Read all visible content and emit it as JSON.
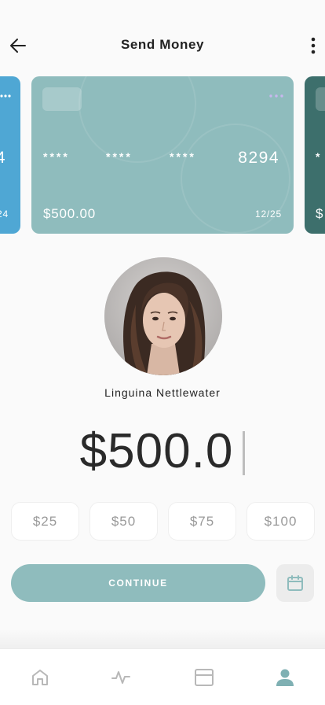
{
  "header": {
    "title": "Send Money",
    "back_icon": "arrow-left-icon",
    "menu_icon": "more-vertical-icon"
  },
  "cards": [
    {
      "partial": "left",
      "last4": "4",
      "expiry": "24",
      "color": "#4fa7d4"
    },
    {
      "partial": "none",
      "mask": [
        "****",
        "****",
        "****"
      ],
      "last4": "8294",
      "balance": "$500.00",
      "expiry": "12/25",
      "color": "#8fbcbd"
    },
    {
      "partial": "right",
      "mask_fragment": "*",
      "balance_fragment": "$",
      "color": "#3d6f6c"
    }
  ],
  "recipient": {
    "name": "Linguina Nettlewater"
  },
  "amount": {
    "value": "$500.0"
  },
  "quick_amounts": [
    "$25",
    "$50",
    "$75",
    "$100"
  ],
  "actions": {
    "continue_label": "CONTINUE",
    "schedule_icon": "calendar-icon"
  },
  "tabbar": {
    "items": [
      {
        "icon": "home-icon",
        "active": false
      },
      {
        "icon": "activity-icon",
        "active": false
      },
      {
        "icon": "card-icon",
        "active": false
      },
      {
        "icon": "user-icon",
        "active": true
      }
    ]
  },
  "colors": {
    "accent": "#8fbcbd",
    "background": "#fafafa",
    "inactive_icon": "#b8b8b8",
    "active_icon": "#7fb0b3"
  }
}
